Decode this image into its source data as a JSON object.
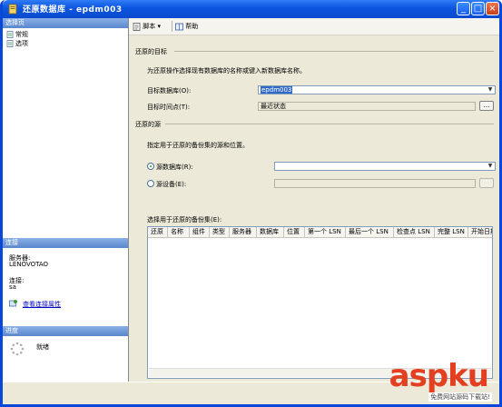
{
  "window": {
    "title": "还原数据库 - epdm003",
    "colors": {
      "titlebar": "#0b56dd",
      "close": "#c9401c"
    }
  },
  "sidebar": {
    "header_select_page": "选择页",
    "items": [
      {
        "label": "常规",
        "icon": "page-icon"
      },
      {
        "label": "选项",
        "icon": "page-icon"
      }
    ],
    "connection": {
      "header": "连接",
      "server_label": "服务器:",
      "server_value": "LENOVOTAO",
      "conn_label": "连接:",
      "conn_value": "sa",
      "view_link": "查看连接属性"
    },
    "progress": {
      "header": "进度",
      "status": "就绪"
    }
  },
  "toolbar": {
    "script_label": "脚本",
    "help_label": "帮助"
  },
  "target": {
    "section_title": "还原的目标",
    "description": "为还原操作选择现有数据库的名称或键入新数据库名称。",
    "db_label": "目标数据库(O):",
    "db_value": "epdm003",
    "time_label": "目标时间点(T):",
    "time_value": "最近状态"
  },
  "source": {
    "section_title": "还原的源",
    "description": "指定用于还原的备份集的源和位置。",
    "from_db_label": "源数据库(R):",
    "from_db_value": "",
    "from_device_label": "源设备(E):",
    "backup_sets_label": "选择用于还原的备份集(E):",
    "columns": [
      "还原",
      "名称",
      "组件",
      "类型",
      "服务器",
      "数据库",
      "位置",
      "第一个 LSN",
      "最后一个 LSN",
      "检查点 LSN",
      "完整 LSN",
      "开始日期"
    ]
  },
  "watermark": {
    "text": "aspku",
    "sub": "免费网站源码下载站!"
  }
}
